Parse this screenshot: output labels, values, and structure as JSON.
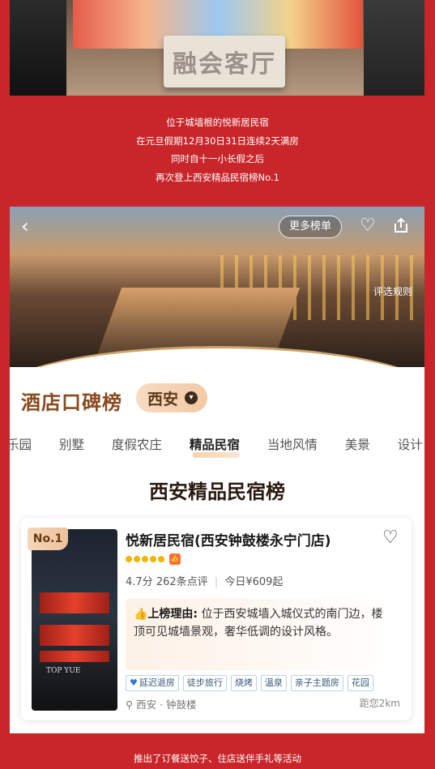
{
  "top_photo": {
    "sign_text": "融会客厅"
  },
  "intro_lines": [
    "位于城墙根的悦新居民宿",
    "在元旦假期12月30日31日连续2天满房",
    "同时自十一小长假之后",
    "再次登上西安精品民宿榜No.1"
  ],
  "hero": {
    "back_icon": "chevron-left-icon",
    "more_button": "更多榜单",
    "heart_icon": "heart-outline-icon",
    "share_icon": "share-icon",
    "rules_link": "评选规则"
  },
  "board": {
    "title": "酒店口碑榜",
    "city": "西安"
  },
  "tabs": [
    "乐园",
    "别墅",
    "度假农庄",
    "精品民宿",
    "当地风情",
    "美景",
    "设计"
  ],
  "active_tab_index": 3,
  "list_title": "西安精品民宿榜",
  "hotel": {
    "rank": "No.1",
    "name": "悦新居民宿(西安钟鼓楼永宁门店)",
    "rating": "4.7分",
    "reviews": "262条点评",
    "price": "今日¥609起",
    "reason_label": "上榜理由:",
    "reason_text": " 位于西安城墙入城仪式的南门边，楼顶可见城墙景观，奢华低调的设计风格。",
    "tags": [
      "延迟退房",
      "徒步旅行",
      "烧烤",
      "温泉",
      "亲子主题房",
      "花园"
    ],
    "location": "西安 · 钟鼓楼",
    "distance": "距您2km",
    "image_logo": "TOP YUE",
    "accent_color": "#f5b400"
  },
  "footer_text": "推出了订餐送饺子、住店送伴手礼等活动",
  "colors": {
    "background": "#c8262b",
    "brand_brown": "#8a4a1e"
  }
}
